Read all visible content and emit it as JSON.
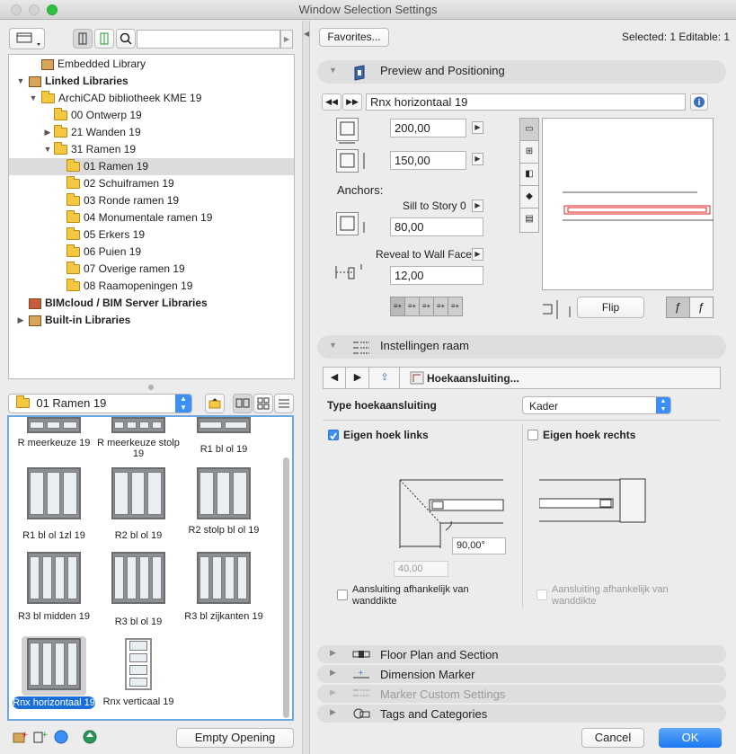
{
  "window": {
    "title": "Window Selection Settings"
  },
  "left": {
    "search": {
      "placeholder": ""
    },
    "tree": [
      {
        "label": "Embedded Library",
        "level": 1,
        "bold": false,
        "icon": "library-icon"
      },
      {
        "label": "Linked Libraries",
        "level": 0,
        "bold": true,
        "icon": "library-icon"
      },
      {
        "label": "ArchiCAD bibliotheek KME 19",
        "level": 1,
        "bold": false,
        "icon": "folder-icon"
      },
      {
        "label": "00 Ontwerp 19",
        "level": 2,
        "bold": false,
        "icon": "folder-icon"
      },
      {
        "label": "21 Wanden 19",
        "level": 2,
        "bold": false,
        "icon": "folder-icon"
      },
      {
        "label": "31 Ramen 19",
        "level": 2,
        "bold": false,
        "icon": "folder-icon"
      },
      {
        "label": "01 Ramen 19",
        "level": 3,
        "bold": false,
        "icon": "folder-icon",
        "selected": true
      },
      {
        "label": "02 Schuiframen 19",
        "level": 3,
        "bold": false,
        "icon": "folder-icon"
      },
      {
        "label": "03 Ronde ramen 19",
        "level": 3,
        "bold": false,
        "icon": "folder-icon"
      },
      {
        "label": "04 Monumentale ramen 19",
        "level": 3,
        "bold": false,
        "icon": "folder-icon"
      },
      {
        "label": "05 Erkers 19",
        "level": 3,
        "bold": false,
        "icon": "folder-icon"
      },
      {
        "label": "06 Puien 19",
        "level": 3,
        "bold": false,
        "icon": "folder-icon"
      },
      {
        "label": "07 Overige ramen 19",
        "level": 3,
        "bold": false,
        "icon": "folder-icon"
      },
      {
        "label": "08 Raamopeningen 19",
        "level": 3,
        "bold": false,
        "icon": "folder-icon"
      },
      {
        "label": "BIMcloud / BIM Server Libraries",
        "level": 0,
        "bold": true,
        "icon": "server-icon"
      },
      {
        "label": "Built-in Libraries",
        "level": 0,
        "bold": true,
        "icon": "library-icon"
      }
    ],
    "folder_select": "01 Ramen 19",
    "gallery": [
      {
        "label": "R meerkeuze 19"
      },
      {
        "label": "R meerkeuze stolp 19"
      },
      {
        "label": "R1 bl ol 19"
      },
      {
        "label": "R1 bl ol 1zl 19"
      },
      {
        "label": "R2 bl ol 19"
      },
      {
        "label": "R2 stolp bl ol 19"
      },
      {
        "label": "R3 bl midden 19"
      },
      {
        "label": "R3 bl ol 19"
      },
      {
        "label": "R3 bl zijkanten 19"
      },
      {
        "label": "Rnx horizontaal 19",
        "selected": true
      },
      {
        "label": "Rnx verticaal 19"
      }
    ],
    "empty_opening": "Empty Opening"
  },
  "right": {
    "favorites": "Favorites...",
    "selected_info": "Selected: 1 Editable: 1",
    "preview": {
      "title": "Preview and Positioning",
      "object_name": "Rnx horizontaal 19",
      "width": "200,00",
      "height": "150,00",
      "anchors_label": "Anchors:",
      "sill_label": "Sill to Story 0",
      "sill_value": "80,00",
      "reveal_label": "Reveal to Wall Face",
      "reveal_value": "12,00",
      "flip": "Flip"
    },
    "instellingen": {
      "title": "Instellingen raam",
      "page_label": "Hoekaansluiting...",
      "type_label": "Type hoekaansluiting",
      "type_value": "Kader",
      "eigen_links": "Eigen hoek links",
      "eigen_rechts": "Eigen hoek rechts",
      "angle_value": "90,00°",
      "depth_value": "40,00",
      "afh_left": "Aansluiting afhankelijk van wanddikte",
      "afh_right": "Aansluiting afhankelijk van wanddikte"
    },
    "sections": [
      "Floor Plan and Section",
      "Dimension Marker",
      "Marker Custom Settings",
      "Tags and Categories"
    ],
    "cancel": "Cancel",
    "ok": "OK"
  },
  "colors": {
    "accent": "#3b8ff6",
    "selection_blue": "#1a6fd6",
    "folder_yellow": "#f5c842"
  }
}
